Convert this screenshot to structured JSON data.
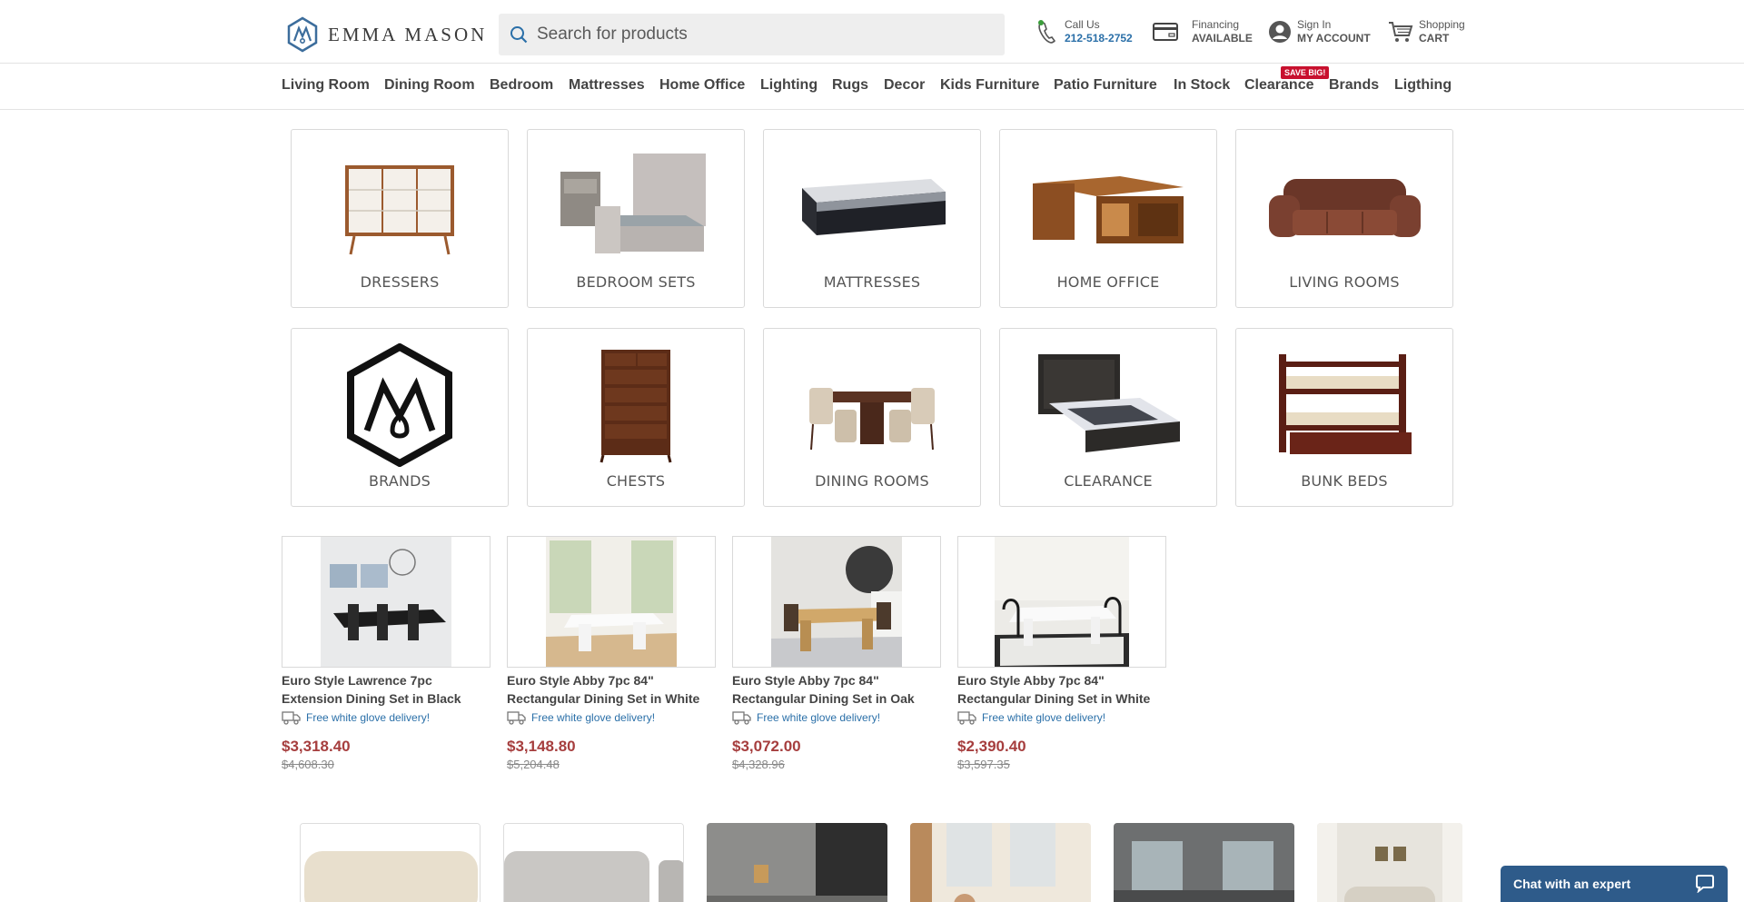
{
  "header": {
    "logo_text": "EMMA MASON",
    "search_placeholder": "Search for products",
    "call_label": "Call Us",
    "call_number": "212-518-2752",
    "financing_label": "Financing",
    "financing_value": "AVAILABLE",
    "signin_label": "Sign In",
    "account_label": "MY ACCOUNT",
    "cart_label": "Shopping",
    "cart_value": "CART"
  },
  "nav": {
    "items": [
      "Living Room",
      "Dining Room",
      "Bedroom",
      "Mattresses",
      "Home Office",
      "Lighting",
      "Rugs",
      "Decor",
      "Kids Furniture",
      "Patio Furniture",
      "In Stock",
      "Clearance",
      "Brands",
      "Ligthing"
    ],
    "badge": "SAVE BIG!"
  },
  "categories": [
    {
      "label": "DRESSERS",
      "icon": "dresser"
    },
    {
      "label": "BEDROOM SETS",
      "icon": "bed"
    },
    {
      "label": "MATTRESSES",
      "icon": "mattress"
    },
    {
      "label": "HOME OFFICE",
      "icon": "desk"
    },
    {
      "label": "LIVING ROOMS",
      "icon": "sofa"
    },
    {
      "label": "BRANDS",
      "icon": "brand-logo"
    },
    {
      "label": "CHESTS",
      "icon": "chest"
    },
    {
      "label": "DINING ROOMS",
      "icon": "dining-set"
    },
    {
      "label": "CLEARANCE",
      "icon": "bed-dark"
    },
    {
      "label": "BUNK BEDS",
      "icon": "bunk-bed"
    }
  ],
  "products": [
    {
      "title": "Euro Style Lawrence 7pc Extension Dining Set in Black",
      "shipping": "Free white glove delivery!",
      "price": "$3,318.40",
      "old_price": "$4,608.30"
    },
    {
      "title": "Euro Style Abby 7pc 84\" Rectangular Dining Set in White",
      "shipping": "Free white glove delivery!",
      "price": "$3,148.80",
      "old_price": "$5,204.48"
    },
    {
      "title": "Euro Style Abby 7pc 84\" Rectangular Dining Set in Oak",
      "shipping": "Free white glove delivery!",
      "price": "$3,072.00",
      "old_price": "$4,328.96"
    },
    {
      "title": "Euro Style Abby 7pc 84\" Rectangular Dining Set in White",
      "shipping": "Free white glove delivery!",
      "price": "$2,390.40",
      "old_price": "$3,597.35"
    }
  ],
  "chat": {
    "label": "Chat with an expert"
  },
  "colors": {
    "accent_blue": "#2a6fa8",
    "price_red": "#a63e3e",
    "badge_red": "#c8102e",
    "chat_blue": "#2e5b8a"
  }
}
